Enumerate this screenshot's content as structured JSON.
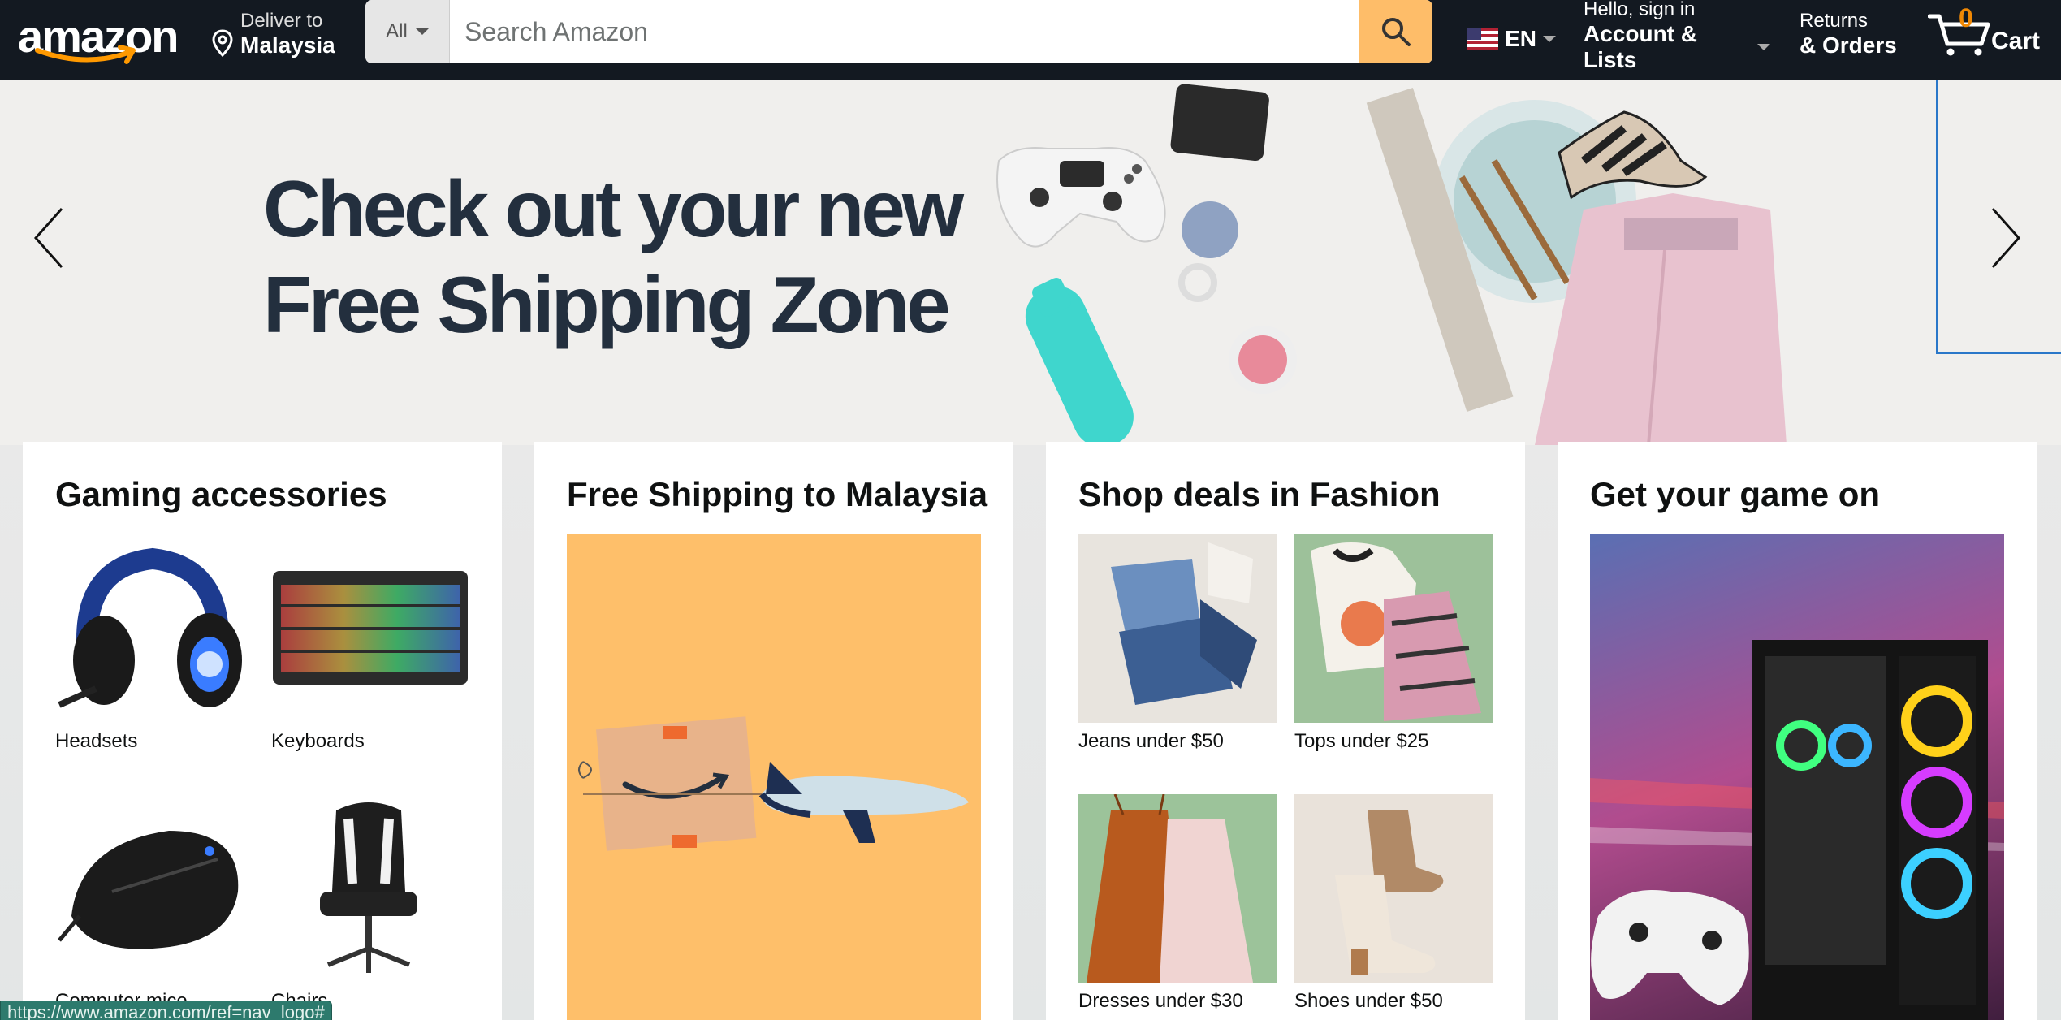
{
  "nav": {
    "logo_text": "amazon",
    "deliver_line1": "Deliver to",
    "deliver_line2": "Malaysia",
    "search_category": "All",
    "search_placeholder": "Search Amazon",
    "language": "EN",
    "account_line1": "Hello, sign in",
    "account_line2": "Account & Lists",
    "returns_line1": "Returns",
    "returns_line2": "& Orders",
    "cart_count": "0",
    "cart_label": "Cart",
    "colors": {
      "bar": "#131921",
      "search_button": "#febd69",
      "cart_count": "#f08804"
    }
  },
  "hero": {
    "headline_line1": "Check out your new",
    "headline_line2": "Free Shipping Zone",
    "prev_icon": "chevron-left-icon",
    "next_icon": "chevron-right-icon"
  },
  "cards": [
    {
      "title": "Gaming accessories",
      "items": [
        {
          "label": "Headsets",
          "icon": "headset-image"
        },
        {
          "label": "Keyboards",
          "icon": "keyboard-image"
        },
        {
          "label": "Computer mice",
          "icon": "mouse-image"
        },
        {
          "label": "Chairs",
          "icon": "chair-image"
        }
      ]
    },
    {
      "title": "Free Shipping to Malaysia",
      "image": "package-airplane-image"
    },
    {
      "title": "Shop deals in Fashion",
      "items": [
        {
          "label": "Jeans under $50",
          "icon": "jeans-image"
        },
        {
          "label": "Tops under $25",
          "icon": "tops-image"
        },
        {
          "label": "Dresses under $30",
          "icon": "dresses-image"
        },
        {
          "label": "Shoes under $50",
          "icon": "shoes-image"
        }
      ]
    },
    {
      "title": "Get your game on",
      "image": "gaming-pc-image"
    }
  ],
  "status_bar": {
    "url": "https://www.amazon.com/ref=nav_logo#"
  }
}
